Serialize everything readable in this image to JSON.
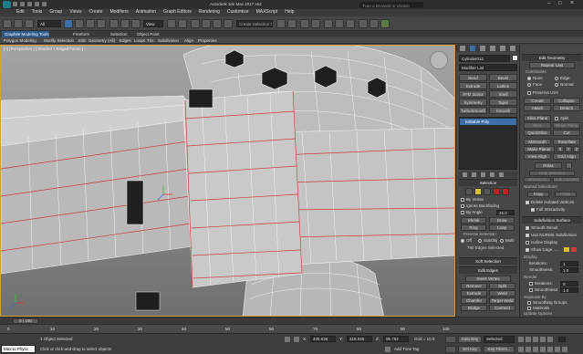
{
  "title_bar": {
    "title": "Autodesk 3ds Max 2017 x64",
    "search_placeholder": "Type a keyword or phrase"
  },
  "menu": [
    "Edit",
    "Tools",
    "Group",
    "Views",
    "Create",
    "Modifiers",
    "Animation",
    "Graph Editors",
    "Rendering",
    "Customize",
    "MAXScript",
    "Help"
  ],
  "toolbar": {
    "filter_value": "All",
    "view_value": "View",
    "selection_set": "Create Selection Se"
  },
  "ribbon_tabs": [
    "Graphite Modeling Tools",
    "Freeform",
    "Selection",
    "Object Paint"
  ],
  "ribbon_sub": [
    "Polygon Modeling",
    "Modify Selection",
    "Edit",
    "Geometry (All)",
    "Edges",
    "Loops",
    "Tris",
    "Subdivision",
    "Align",
    "Properties"
  ],
  "viewport": {
    "label": "[+] [Perspective ] [ Shaded + Edged Faces ]"
  },
  "command_panel": {
    "object_name": "Cylinder012",
    "modifier_list": "Modifier List",
    "modifier_buttons": [
      "Bend",
      "Bevel",
      "Extrude",
      "Lattice",
      "FFD 3x3x3",
      "Shell",
      "Symmetry",
      "Taper",
      "TurboSmooth",
      "Smooth"
    ],
    "stack_item": "Editable Poly"
  },
  "selection_rollout": {
    "header": "Selection",
    "by_vertex": "By Vertex",
    "ignore_backfacing": "Ignore Backfacing",
    "by_angle": "By Angle",
    "angle_value": "45.0",
    "shrink": "Shrink",
    "grow": "Grow",
    "ring": "Ring",
    "loop": "Loop",
    "preview_selection": "Preview Selection",
    "off": "Off",
    "subobj": "SubObj",
    "multi": "Multi",
    "status": "790 Edges Selected"
  },
  "soft_selection": {
    "header": "Soft Selection"
  },
  "edit_edges": {
    "header": "Edit Edges",
    "insert_vertex": "Insert Vertex",
    "remove": "Remove",
    "split": "Split",
    "extrude": "Extrude",
    "weld": "Weld",
    "chamfer": "Chamfer",
    "target_weld": "Target Weld",
    "bridge": "Bridge",
    "connect": "Connect",
    "create_shape": "Create Shape From Selection",
    "weight_label": "Weight:",
    "weight_value": "1.0",
    "crease_label": "Crease:",
    "crease_value": "0.0"
  },
  "edit_geometry": {
    "header": "Edit Geometry",
    "repeat_last": "Repeat Last",
    "constraints": "Constraints",
    "none": "None",
    "edge": "Edge",
    "face": "Face",
    "normal": "Normal",
    "preserve_uvs": "Preserve UVs",
    "create": "Create",
    "collapse": "Collapse",
    "attach": "Attach",
    "detach": "Detach",
    "slice_plane": "Slice Plane",
    "split": "Split",
    "slice": "Slice",
    "reset_plane": "Reset Plane",
    "quickslice": "QuickSlice",
    "cut": "Cut",
    "msmooth": "MSmooth",
    "tessellate": "Tessellate",
    "make_planar": "Make Planar",
    "x": "X",
    "y": "Y",
    "z": "Z",
    "view_align": "View Align",
    "grid_align": "Grid Align",
    "relax": "Relax",
    "hide_selected": "Hide Selected",
    "unhide_all": "Unhide All",
    "hide_unselected": "Hide Unselected",
    "named_selections": "Named Selections:",
    "copy": "Copy",
    "paste": "Paste",
    "delete_isolated": "Delete Isolated Vertices",
    "full_interactivity": "Full Interactivity"
  },
  "subdivision": {
    "header": "Subdivision Surface",
    "smooth_result": "Smooth Result",
    "use_nurms": "Use NURMS Subdivision",
    "isoline": "Isoline Display",
    "show_cage": "Show Cage......",
    "display": "Display",
    "iterations_label": "Iterations:",
    "iterations_value": "1",
    "smoothness_label": "Smoothness:",
    "smoothness_value": "1.0",
    "render": "Render",
    "r_iterations_value": "0",
    "r_smoothness_value": "1.0",
    "separate_by": "Separate By",
    "smoothing_groups": "Smoothing Groups",
    "materials": "Materials",
    "update_options": "Update Options",
    "always": "Always",
    "when_rendering": "When Rendering",
    "manually": "Manually"
  },
  "timeline": {
    "frame": "0 / 100",
    "ticks": [
      "0",
      "10",
      "20",
      "30",
      "40",
      "50",
      "60",
      "70",
      "80",
      "90",
      "100"
    ]
  },
  "status": {
    "maxscript": "Max to Physc",
    "objects": "1 Object Selected",
    "prompt": "Click or click-and-drag to select objects",
    "x_label": "X:",
    "x_value": "405.636",
    "y_label": "Y:",
    "y_value": "318.048",
    "z_label": "Z:",
    "z_value": "95.792",
    "grid": "Grid = 10.0",
    "add_time_tag": "Add Time Tag",
    "auto_key": "Auto Key",
    "selected": "Selected",
    "set_key": "Set Key",
    "key_filters": "Key Filters..."
  },
  "colors": {
    "accent_blue": "#3d6ea8",
    "edge_red": "#d03a3a",
    "bg": "#444444"
  }
}
